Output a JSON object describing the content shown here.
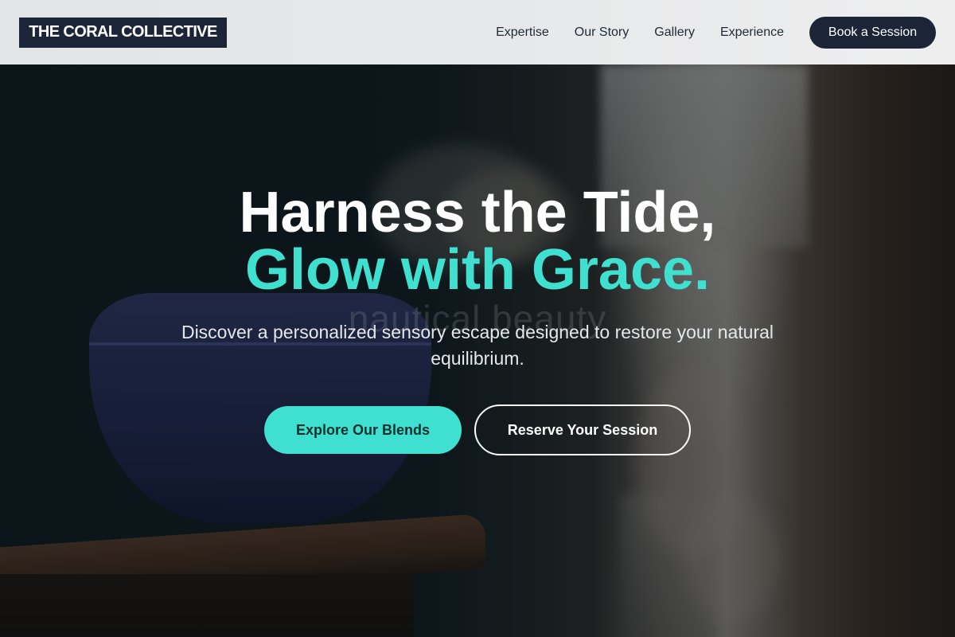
{
  "brand": {
    "logo_text": "THE CORAL COLLECTIVE"
  },
  "nav": {
    "links": [
      {
        "label": "Expertise"
      },
      {
        "label": "Our Story"
      },
      {
        "label": "Gallery"
      },
      {
        "label": "Experience"
      }
    ],
    "cta_label": "Book a Session"
  },
  "hero": {
    "headline_line1": "Harness the Tide,",
    "headline_line2": "Glow with Grace.",
    "background_text": "nautical beauty",
    "subtitle": "Discover a personalized sensory escape designed to restore your natural equilibrium.",
    "primary_cta": "Explore Our Blends",
    "secondary_cta": "Reserve Your Session"
  },
  "colors": {
    "accent": "#40e0d0",
    "navy": "#1c2438",
    "header_bg": "#e8e9ea"
  }
}
